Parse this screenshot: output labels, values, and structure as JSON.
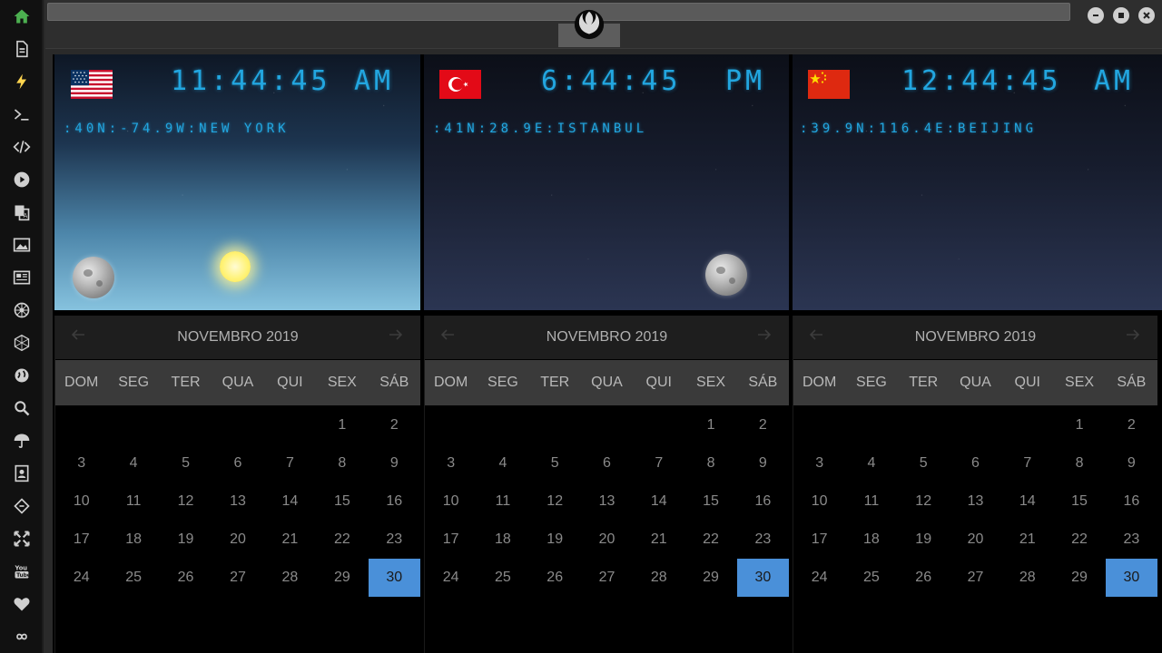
{
  "sidebar": {
    "items": [
      {
        "icon": "home-icon",
        "active": true
      },
      {
        "icon": "document-icon"
      },
      {
        "icon": "lightning-icon"
      },
      {
        "icon": "terminal-icon"
      },
      {
        "icon": "code-icon"
      },
      {
        "icon": "play-icon"
      },
      {
        "icon": "translate-icon"
      },
      {
        "icon": "image-icon"
      },
      {
        "icon": "newspaper-icon"
      },
      {
        "icon": "empire-icon"
      },
      {
        "icon": "hexagon-icon"
      },
      {
        "icon": "globe-icon"
      },
      {
        "icon": "search-icon"
      },
      {
        "icon": "umbrella-icon"
      },
      {
        "icon": "contacts-icon"
      },
      {
        "icon": "diamond-code-icon"
      },
      {
        "icon": "expand-icon"
      },
      {
        "icon": "youtube-icon"
      },
      {
        "icon": "heart-icon"
      },
      {
        "icon": "infinity-icon"
      }
    ]
  },
  "colors": {
    "accent": "#22a6e0",
    "selected_day": "#4a90d9",
    "home_active": "#4caf50"
  },
  "clocks": [
    {
      "flag": "usa-flag-icon",
      "time": "11:44:45",
      "ampm": "AM",
      "location": ":40N:-74.9W:NEW YORK",
      "sky": "day"
    },
    {
      "flag": "turkey-flag-icon",
      "time": "6:44:45",
      "ampm": "PM",
      "location": ":41N:28.9E:ISTANBUL",
      "sky": "night"
    },
    {
      "flag": "china-flag-icon",
      "time": "12:44:45",
      "ampm": "AM",
      "location": ":39.9N:116.4E:BEIJING",
      "sky": "night"
    }
  ],
  "calendars": [
    {
      "title": "NOVEMBRO 2019"
    },
    {
      "title": "NOVEMBRO 2019"
    },
    {
      "title": "NOVEMBRO 2019"
    }
  ],
  "weekdays": [
    "DOM",
    "SEG",
    "TER",
    "QUA",
    "QUI",
    "SEX",
    "SÁB"
  ],
  "month": {
    "leading_blanks": 5,
    "days": [
      "1",
      "2",
      "3",
      "4",
      "5",
      "6",
      "7",
      "8",
      "9",
      "10",
      "11",
      "12",
      "13",
      "14",
      "15",
      "16",
      "17",
      "18",
      "19",
      "20",
      "21",
      "22",
      "23",
      "24",
      "25",
      "26",
      "27",
      "28",
      "29",
      "30"
    ],
    "selected": "30"
  }
}
